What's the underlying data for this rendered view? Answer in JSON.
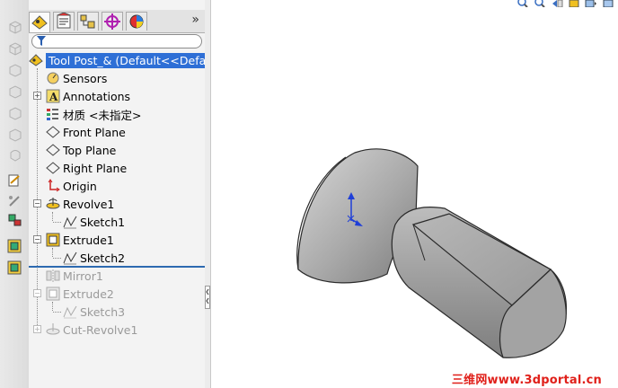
{
  "feature_tree": {
    "root_label": "Tool Post_&  (Default<<Defa",
    "items": [
      {
        "label": "Sensors"
      },
      {
        "label": "Annotations"
      },
      {
        "label": "材质 <未指定>"
      },
      {
        "label": "Front Plane"
      },
      {
        "label": "Top Plane"
      },
      {
        "label": "Right Plane"
      },
      {
        "label": "Origin"
      },
      {
        "label": "Revolve1"
      },
      {
        "label": "Sketch1"
      },
      {
        "label": "Extrude1"
      },
      {
        "label": "Sketch2"
      },
      {
        "label": "Mirror1"
      },
      {
        "label": "Extrude2"
      },
      {
        "label": "Sketch3"
      },
      {
        "label": "Cut-Revolve1"
      }
    ],
    "suppressed_color": "#9a9a9a",
    "selected_color": "#2e6fd6"
  },
  "tabs": {
    "more": "»",
    "icons": [
      "feature-manager-icon",
      "property-manager-icon",
      "configuration-manager-icon",
      "dimxpert-icon",
      "display-manager-icon"
    ]
  },
  "watermark": "三维网www.3dportal.cn"
}
